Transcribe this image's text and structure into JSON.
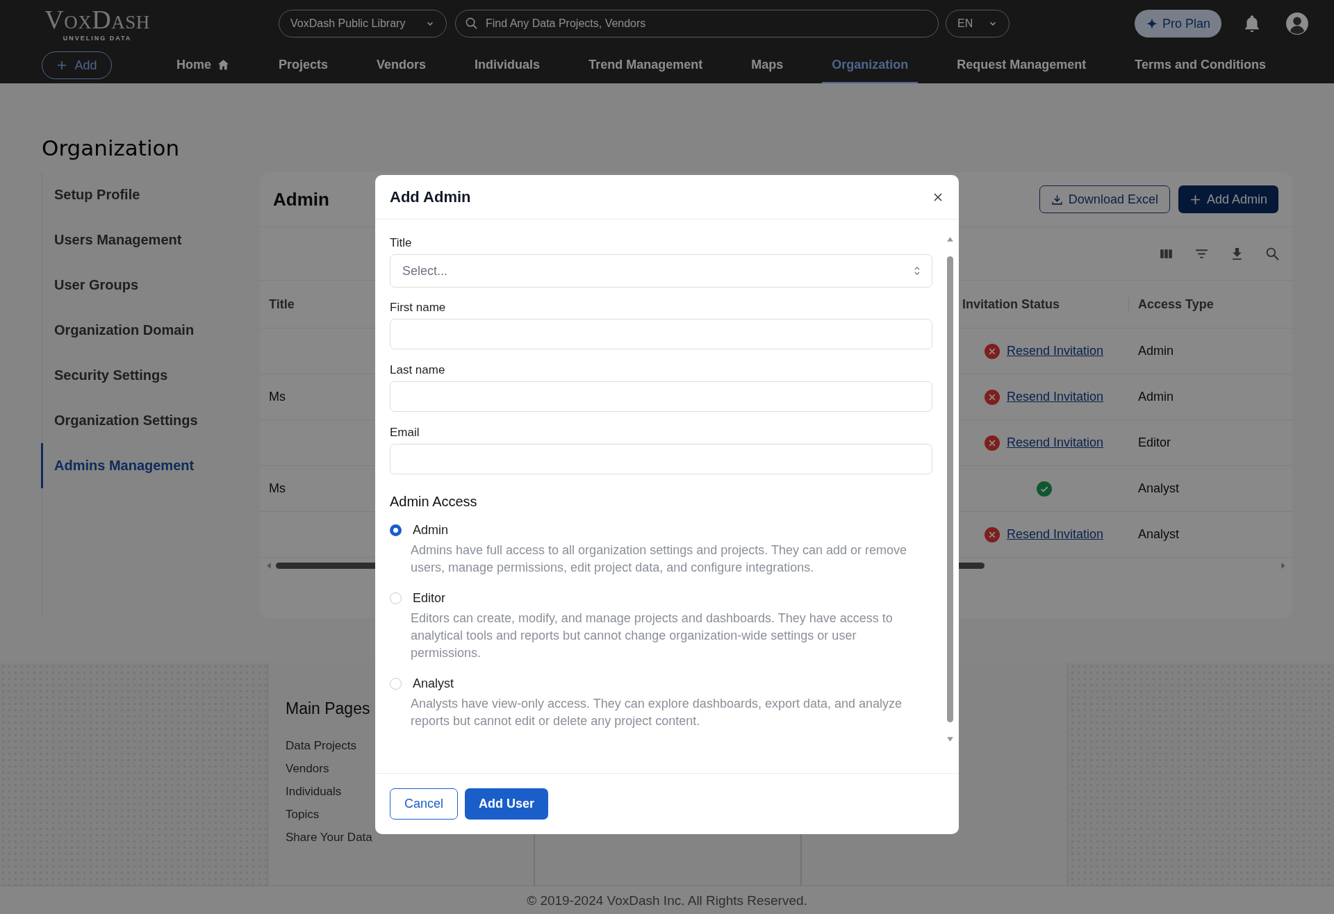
{
  "header": {
    "logo": "VoxDash",
    "tagline": "UNVELING DATA",
    "library_select": "VoxDash Public Library",
    "search": {
      "placeholder": "Find Any Data Projects, Vendors"
    },
    "language": "EN",
    "pro_button": "Pro Plan"
  },
  "nav": {
    "add_button": "Add",
    "items": [
      {
        "label": "Home",
        "kind": "home",
        "selected": false
      },
      {
        "label": "Projects",
        "kind": "plain",
        "selected": false
      },
      {
        "label": "Vendors",
        "kind": "plain",
        "selected": false
      },
      {
        "label": "Individuals",
        "kind": "plain",
        "selected": false
      },
      {
        "label": "Trend Management",
        "kind": "plain",
        "selected": false
      },
      {
        "label": "Maps",
        "kind": "plain",
        "selected": false
      },
      {
        "label": "Organization",
        "kind": "plain",
        "selected": true
      },
      {
        "label": "Request Management",
        "kind": "plain",
        "selected": false
      },
      {
        "label": "Terms and Conditions",
        "kind": "plain",
        "selected": false
      }
    ]
  },
  "page_title": "Organization",
  "sidebar": {
    "items": [
      {
        "label": "Setup Profile",
        "selected": false
      },
      {
        "label": "Users Management",
        "selected": false
      },
      {
        "label": "User Groups",
        "selected": false
      },
      {
        "label": "Organization Domain",
        "selected": false
      },
      {
        "label": "Security Settings",
        "selected": false
      },
      {
        "label": "Organization Settings",
        "selected": false
      },
      {
        "label": "Admins Management",
        "selected": true
      }
    ]
  },
  "admin_card": {
    "title": "Admin",
    "buttons": [
      {
        "label": "Download Excel",
        "kind": "outline"
      },
      {
        "label": "Add Admin",
        "kind": "primary"
      }
    ],
    "table": {
      "columns": [
        "Title",
        "Invitation Status",
        "Access Type"
      ],
      "rows": [
        {
          "status": {
            "kind": "failed",
            "link": "Resend Invitation"
          },
          "access_type": "Admin"
        },
        {
          "title": "Ms",
          "status": {
            "kind": "failed",
            "link": "Resend Invitation"
          },
          "access_type": "Admin"
        },
        {
          "status": {
            "kind": "failed",
            "link": "Resend Invitation"
          },
          "access_type": "Editor"
        },
        {
          "title": "Ms",
          "status": {
            "kind": "accepted"
          },
          "access_type": "Analyst"
        },
        {
          "status": {
            "kind": "failed",
            "link": "Resend Invitation"
          },
          "access_type": "Analyst"
        }
      ]
    }
  },
  "modal": {
    "title": "Add Admin",
    "fields": [
      {
        "label": "Title",
        "kind": "select",
        "placeholder": "Select..."
      },
      {
        "label": "First name",
        "kind": "text"
      },
      {
        "label": "Last name",
        "kind": "text"
      },
      {
        "label": "Email",
        "kind": "text"
      }
    ],
    "section_title": "Admin Access",
    "options": [
      {
        "label": "Admin",
        "selected": true,
        "description": "Admins have full access to all organization settings and projects. They can add or remove users, manage permissions, edit project data, and configure integrations."
      },
      {
        "label": "Editor",
        "selected": false,
        "description": "Editors can create, modify, and manage projects and dashboards. They have access to analytical tools and reports but cannot change organization-wide settings or user permissions."
      },
      {
        "label": "Analyst",
        "selected": false,
        "description": "Analysts have view-only access. They can explore dashboards, export data, and analyze reports but cannot edit or delete any project content."
      }
    ],
    "buttons": [
      {
        "label": "Cancel",
        "kind": "outline"
      },
      {
        "label": "Add User",
        "kind": "primary"
      }
    ]
  },
  "footer": {
    "section_title": "Main Pages",
    "links": [
      "Data Projects",
      "Vendors",
      "Individuals",
      "Topics",
      "Share Your Data"
    ],
    "copyright": "© 2019-2024 VoxDash Inc. All Rights Reserved."
  }
}
